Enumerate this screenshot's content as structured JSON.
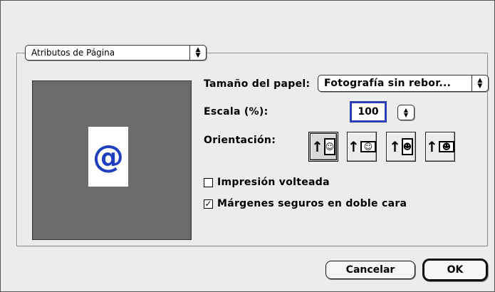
{
  "section_popup": {
    "value": "Atributos de Página"
  },
  "paper_size": {
    "label": "Tamaño del papel:",
    "value": "Fotografía sin rebor..."
  },
  "scale": {
    "label": "Escala (%):",
    "value": "100"
  },
  "orientation": {
    "label": "Orientación:",
    "buttons": [
      {
        "name": "portrait",
        "selected": true
      },
      {
        "name": "landscape",
        "selected": false
      },
      {
        "name": "reverse-portrait",
        "selected": false
      },
      {
        "name": "reverse-landscape",
        "selected": false
      }
    ]
  },
  "preview": {
    "glyph": "@"
  },
  "options": {
    "flip": {
      "label": "Impresión volteada",
      "checked": false
    },
    "safe_margins": {
      "label": "Márgenes seguros en doble cara",
      "checked": true
    }
  },
  "buttons": {
    "cancel": "Cancelar",
    "ok": "OK"
  },
  "colors": {
    "focus_ring": "#2c3fb6",
    "preview_bg": "#6b6b6b",
    "glyph": "#1f3fbf"
  }
}
